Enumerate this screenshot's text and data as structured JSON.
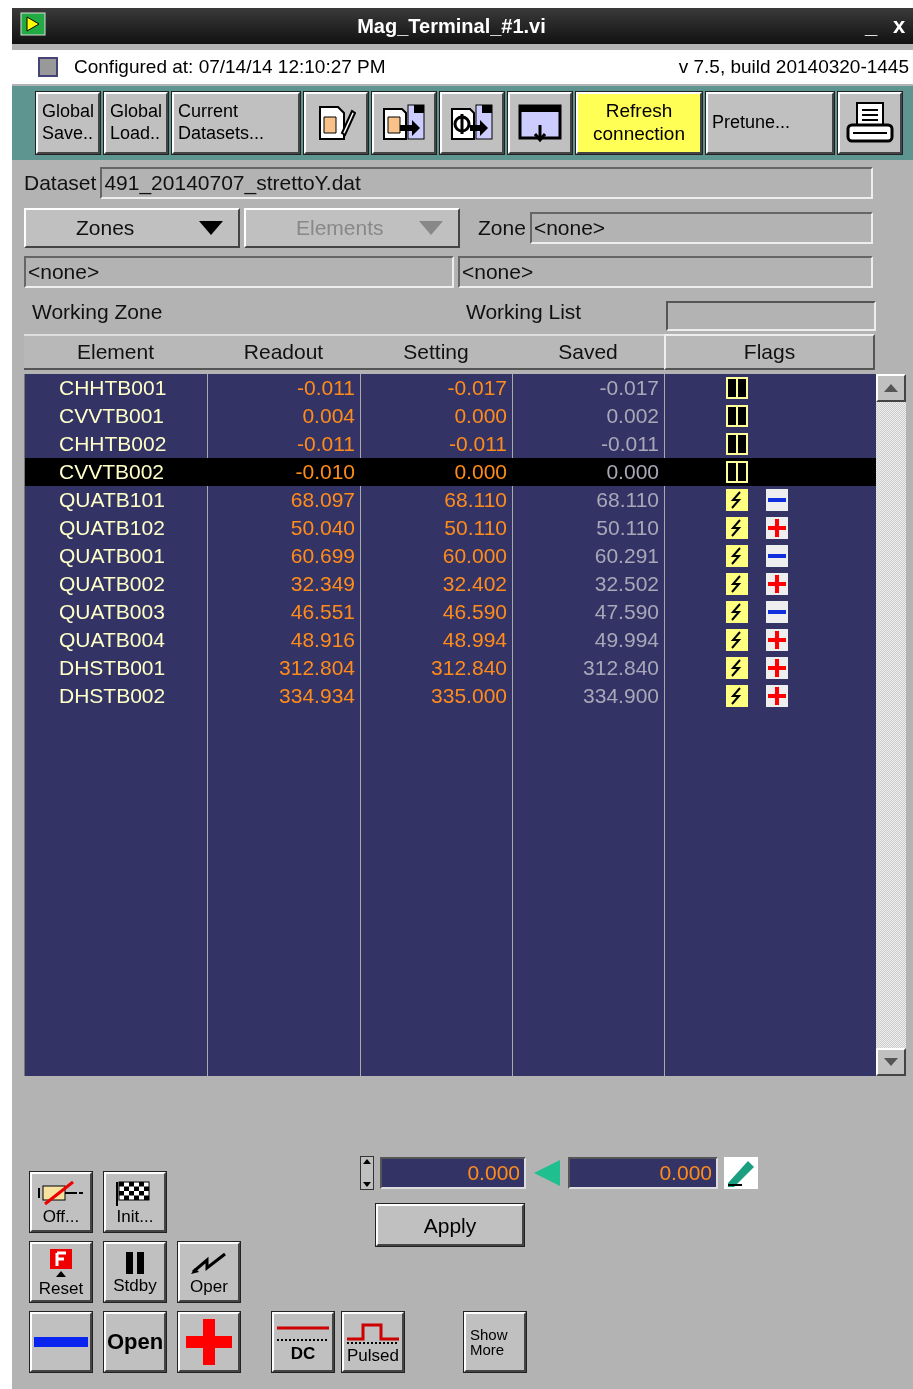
{
  "window": {
    "title": "Mag_Terminal_#1.vi",
    "minimize": "_",
    "close": "x"
  },
  "config": {
    "configured": "Configured at: 07/14/14 12:10:27 PM",
    "version": "v 7.5, build 20140320-1445"
  },
  "toolbar": [
    {
      "kind": "text",
      "label": "Global Save..",
      "highlighted": false
    },
    {
      "kind": "text",
      "label": "Global Load..",
      "highlighted": false
    },
    {
      "kind": "text",
      "label": "Current Datasets...",
      "highlighted": false
    },
    {
      "kind": "edit"
    },
    {
      "kind": "export"
    },
    {
      "kind": "phi"
    },
    {
      "kind": "download"
    },
    {
      "kind": "text",
      "label": "Refresh connection",
      "highlighted": true
    },
    {
      "kind": "text",
      "label": "Pretune...",
      "highlighted": false
    },
    {
      "kind": "print"
    }
  ],
  "dataset": {
    "label": "Dataset",
    "value": "491_20140707_strettoY.dat"
  },
  "selectors": [
    {
      "label": "Zones",
      "disabled": false
    },
    {
      "label": "Elements",
      "disabled": true
    }
  ],
  "zone": {
    "label": "Zone",
    "value": "<none>"
  },
  "working_zone": {
    "value": "<none>",
    "label": "Working Zone"
  },
  "working_list": {
    "value": "<none>",
    "label": "Working List"
  },
  "table": {
    "columns": [
      "Element",
      "Readout",
      "Setting",
      "Saved",
      "Flags"
    ],
    "rows": [
      {
        "element": "CHHTB001",
        "readout": "-0.011",
        "setting": "-0.017",
        "saved": "-0.017",
        "kind": "standby",
        "selected": false
      },
      {
        "element": "CVVTB001",
        "readout": "0.004",
        "setting": "0.000",
        "saved": "0.002",
        "kind": "standby",
        "selected": false
      },
      {
        "element": "CHHTB002",
        "readout": "-0.011",
        "setting": "-0.011",
        "saved": "-0.011",
        "kind": "standby",
        "selected": false
      },
      {
        "element": "CVVTB002",
        "readout": "-0.010",
        "setting": "0.000",
        "saved": "0.000",
        "kind": "standby",
        "selected": true
      },
      {
        "element": "QUATB101",
        "readout": "68.097",
        "setting": "68.110",
        "saved": "68.110",
        "kind": "operating",
        "positive": false,
        "selected": false
      },
      {
        "element": "QUATB102",
        "readout": "50.040",
        "setting": "50.110",
        "saved": "50.110",
        "kind": "operating",
        "positive": true,
        "selected": false
      },
      {
        "element": "QUATB001",
        "readout": "60.699",
        "setting": "60.000",
        "saved": "60.291",
        "kind": "operating",
        "positive": false,
        "selected": false
      },
      {
        "element": "QUATB002",
        "readout": "32.349",
        "setting": "32.402",
        "saved": "32.502",
        "kind": "operating",
        "positive": true,
        "selected": false
      },
      {
        "element": "QUATB003",
        "readout": "46.551",
        "setting": "46.590",
        "saved": "47.590",
        "kind": "operating",
        "positive": false,
        "selected": false
      },
      {
        "element": "QUATB004",
        "readout": "48.916",
        "setting": "48.994",
        "saved": "49.994",
        "kind": "operating",
        "positive": true,
        "selected": false
      },
      {
        "element": "DHSTB001",
        "readout": "312.804",
        "setting": "312.840",
        "saved": "312.840",
        "kind": "operating",
        "positive": true,
        "selected": false
      },
      {
        "element": "DHSTB002",
        "readout": "334.934",
        "setting": "335.000",
        "saved": "334.900",
        "kind": "operating",
        "positive": true,
        "selected": false
      }
    ]
  },
  "setpoint": {
    "target": "0.000",
    "current": "0.000",
    "apply": "Apply"
  },
  "controls": [
    {
      "kind": "off",
      "label": "Off..."
    },
    {
      "kind": "init",
      "label": "Init..."
    },
    {
      "kind": "reset",
      "label": "Reset"
    },
    {
      "kind": "stdby",
      "label": "Stdby"
    },
    {
      "kind": "oper",
      "label": "Oper"
    },
    {
      "kind": "minus"
    },
    {
      "kind": "open",
      "label": "Open"
    },
    {
      "kind": "plus"
    }
  ],
  "modes": [
    {
      "kind": "dc",
      "label": "DC"
    },
    {
      "kind": "pulsed",
      "label": "Pulsed"
    }
  ],
  "show_more": "Show More"
}
